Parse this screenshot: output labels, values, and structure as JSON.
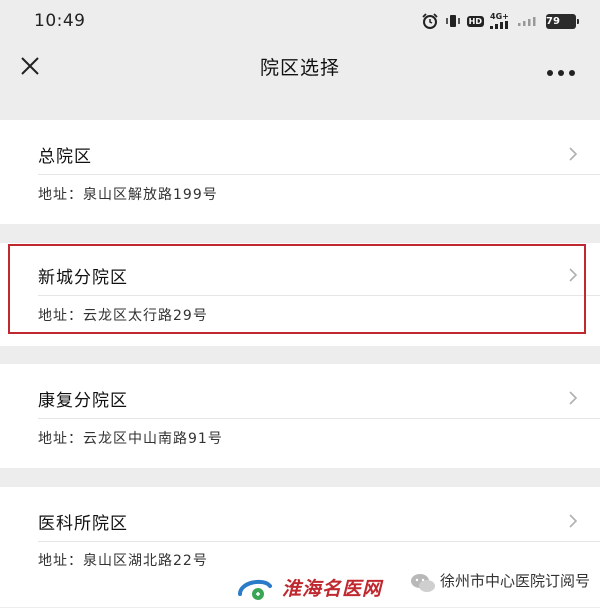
{
  "status_bar": {
    "time": "10:49",
    "hd_badge": "HD",
    "net_label": "4G+",
    "battery": "79",
    "icons": [
      "alarm-icon",
      "vibrate-icon",
      "hd-icon",
      "signal-icon",
      "wifi-dots-icon",
      "battery-icon"
    ]
  },
  "nav": {
    "title": "院区选择",
    "close_icon": "close-icon",
    "more_icon": "more-icon"
  },
  "campuses": [
    {
      "name": "总院区",
      "address": "地址：泉山区解放路199号"
    },
    {
      "name": "新城分院区",
      "address": "地址：云龙区太行路29号"
    },
    {
      "name": "康复分院区",
      "address": "地址：云龙区中山南路91号"
    },
    {
      "name": "医科所院区",
      "address": "地址：泉山区湖北路22号"
    }
  ],
  "highlight_color": "#c0282f",
  "watermark": {
    "brand": "淮海名医网",
    "account": "徐州市中心医院订阅号"
  }
}
